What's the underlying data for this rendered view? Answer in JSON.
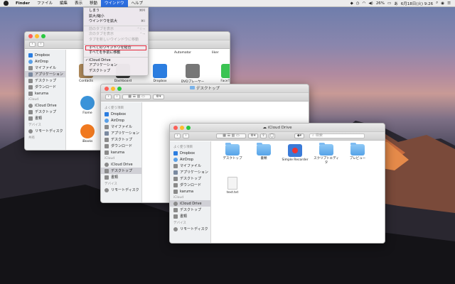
{
  "menubar": {
    "app": "Finder",
    "items": [
      "ファイル",
      "編集",
      "表示",
      "移動",
      "ウインドウ",
      "ヘルプ"
    ],
    "active_index": 4,
    "battery": "26%",
    "date": "6月18日(火) 9:26"
  },
  "window_menu": {
    "items": [
      {
        "label": "しまう",
        "shortcut": "⌘M",
        "disabled": false
      },
      {
        "label": "拡大/縮小",
        "shortcut": "",
        "disabled": false
      },
      {
        "label": "ウインドウを拡大",
        "shortcut": "⌘I",
        "disabled": false
      },
      {
        "label": "前のタブを表示",
        "shortcut": "^⇧→",
        "disabled": true
      },
      {
        "label": "次のタブを表示",
        "shortcut": "^→",
        "disabled": true
      },
      {
        "label": "タブを新しいウインドウに移動",
        "shortcut": "",
        "disabled": true
      },
      {
        "label": "すべてのウインドウを結合",
        "shortcut": "",
        "disabled": false,
        "highlighted": true
      },
      {
        "label": "すべてを手前に移動",
        "shortcut": "",
        "disabled": false
      },
      {
        "label": "iCloud Drive",
        "shortcut": "",
        "disabled": false,
        "checked": true
      },
      {
        "label": "アプリケーション",
        "shortcut": "",
        "disabled": false
      },
      {
        "label": "デスクトップ",
        "shortcut": "",
        "disabled": false
      }
    ]
  },
  "win_apps": {
    "title": "",
    "apps": [
      {
        "label": "Contacts",
        "icon": "contacts-icon",
        "color": "#b08a5a"
      },
      {
        "label": "Dashboard",
        "icon": "dashboard-icon",
        "color": "#3c3c3c"
      },
      {
        "label": "Dropbox",
        "icon": "dropbox-icon",
        "color": "#2b7de0"
      },
      {
        "label": "DVDプレーヤー",
        "icon": "dvd-icon",
        "color": "#777777"
      },
      {
        "label": "FaceTime",
        "icon": "facetime-icon",
        "color": "#3bc453"
      },
      {
        "label": "Fiome",
        "icon": "camera-icon",
        "color": "#3a93d9"
      },
      {
        "label": "iBooks",
        "icon": "ibooks-icon",
        "color": "#f0791f"
      }
    ],
    "top_labels": [
      "Store",
      "Automator",
      "liker"
    ],
    "sidebar": [
      {
        "type": "item",
        "label": "Dropbox",
        "icon": "dropbox-icon"
      },
      {
        "type": "item",
        "label": "AirDrop",
        "icon": "airdrop-icon"
      },
      {
        "type": "item",
        "label": "マイファイル",
        "icon": "files-icon"
      },
      {
        "type": "item",
        "label": "アプリケーション",
        "icon": "apps-icon",
        "selected": true
      },
      {
        "type": "item",
        "label": "デスクトップ",
        "icon": "desktop-icon"
      },
      {
        "type": "item",
        "label": "ダウンロード",
        "icon": "download-icon"
      },
      {
        "type": "item",
        "label": "karuma",
        "icon": "home-icon"
      },
      {
        "type": "head",
        "label": "iCloud"
      },
      {
        "type": "item",
        "label": "iCloud Drive",
        "icon": "cloud-icon"
      },
      {
        "type": "item",
        "label": "デスクトップ",
        "icon": "desktop-icon"
      },
      {
        "type": "item",
        "label": "書類",
        "icon": "doc-icon"
      },
      {
        "type": "head",
        "label": "デバイス"
      },
      {
        "type": "item",
        "label": "リモートディスク",
        "icon": "disk-icon"
      },
      {
        "type": "head",
        "label": "共有"
      }
    ]
  },
  "win_desktop": {
    "title": "デスクトップ",
    "sidebar": [
      {
        "type": "head",
        "label": "よく使う項目"
      },
      {
        "type": "item",
        "label": "Dropbox",
        "icon": "dropbox-icon"
      },
      {
        "type": "item",
        "label": "AirDrop",
        "icon": "airdrop-icon"
      },
      {
        "type": "item",
        "label": "マイファイル",
        "icon": "files-icon"
      },
      {
        "type": "item",
        "label": "アプリケーション",
        "icon": "apps-icon"
      },
      {
        "type": "item",
        "label": "デスクトップ",
        "icon": "desktop-icon"
      },
      {
        "type": "item",
        "label": "ダウンロード",
        "icon": "download-icon"
      },
      {
        "type": "item",
        "label": "karuma",
        "icon": "home-icon"
      },
      {
        "type": "head",
        "label": "iCloud"
      },
      {
        "type": "item",
        "label": "iCloud Drive",
        "icon": "cloud-icon"
      },
      {
        "type": "item",
        "label": "デスクトップ",
        "icon": "desktop-icon",
        "selected": true
      },
      {
        "type": "item",
        "label": "書類",
        "icon": "doc-icon"
      },
      {
        "type": "head",
        "label": "デバイス"
      },
      {
        "type": "item",
        "label": "リモートディスク",
        "icon": "disk-icon"
      }
    ]
  },
  "win_icloud": {
    "title": "iCloud Drive",
    "search_placeholder": "検索",
    "sidebar": [
      {
        "type": "head",
        "label": "よく使う項目"
      },
      {
        "type": "item",
        "label": "Dropbox",
        "icon": "dropbox-icon"
      },
      {
        "type": "item",
        "label": "AirDrop",
        "icon": "airdrop-icon"
      },
      {
        "type": "item",
        "label": "マイファイル",
        "icon": "files-icon"
      },
      {
        "type": "item",
        "label": "アプリケーション",
        "icon": "apps-icon"
      },
      {
        "type": "item",
        "label": "デスクトップ",
        "icon": "desktop-icon"
      },
      {
        "type": "item",
        "label": "ダウンロード",
        "icon": "download-icon"
      },
      {
        "type": "item",
        "label": "karuma",
        "icon": "home-icon"
      },
      {
        "type": "head",
        "label": "iCloud"
      },
      {
        "type": "item",
        "label": "iCloud Drive",
        "icon": "cloud-icon",
        "selected": true
      },
      {
        "type": "item",
        "label": "デスクトップ",
        "icon": "desktop-icon"
      },
      {
        "type": "item",
        "label": "書類",
        "icon": "doc-icon"
      },
      {
        "type": "head",
        "label": "デバイス"
      },
      {
        "type": "item",
        "label": "リモートディスク",
        "icon": "disk-icon"
      }
    ],
    "files": [
      {
        "label": "デスクトップ",
        "kind": "folder"
      },
      {
        "label": "書類",
        "kind": "folder"
      },
      {
        "label": "Simple Recorder",
        "kind": "app"
      },
      {
        "label": "スクリプトエディタ",
        "kind": "folder"
      },
      {
        "label": "プレビュー",
        "kind": "folder"
      },
      {
        "label": "text.txt",
        "kind": "txt"
      }
    ]
  },
  "colors": {
    "accent": "#2d6fe0",
    "highlight_box": "#e2273a",
    "folder": "#5aa7ea"
  }
}
